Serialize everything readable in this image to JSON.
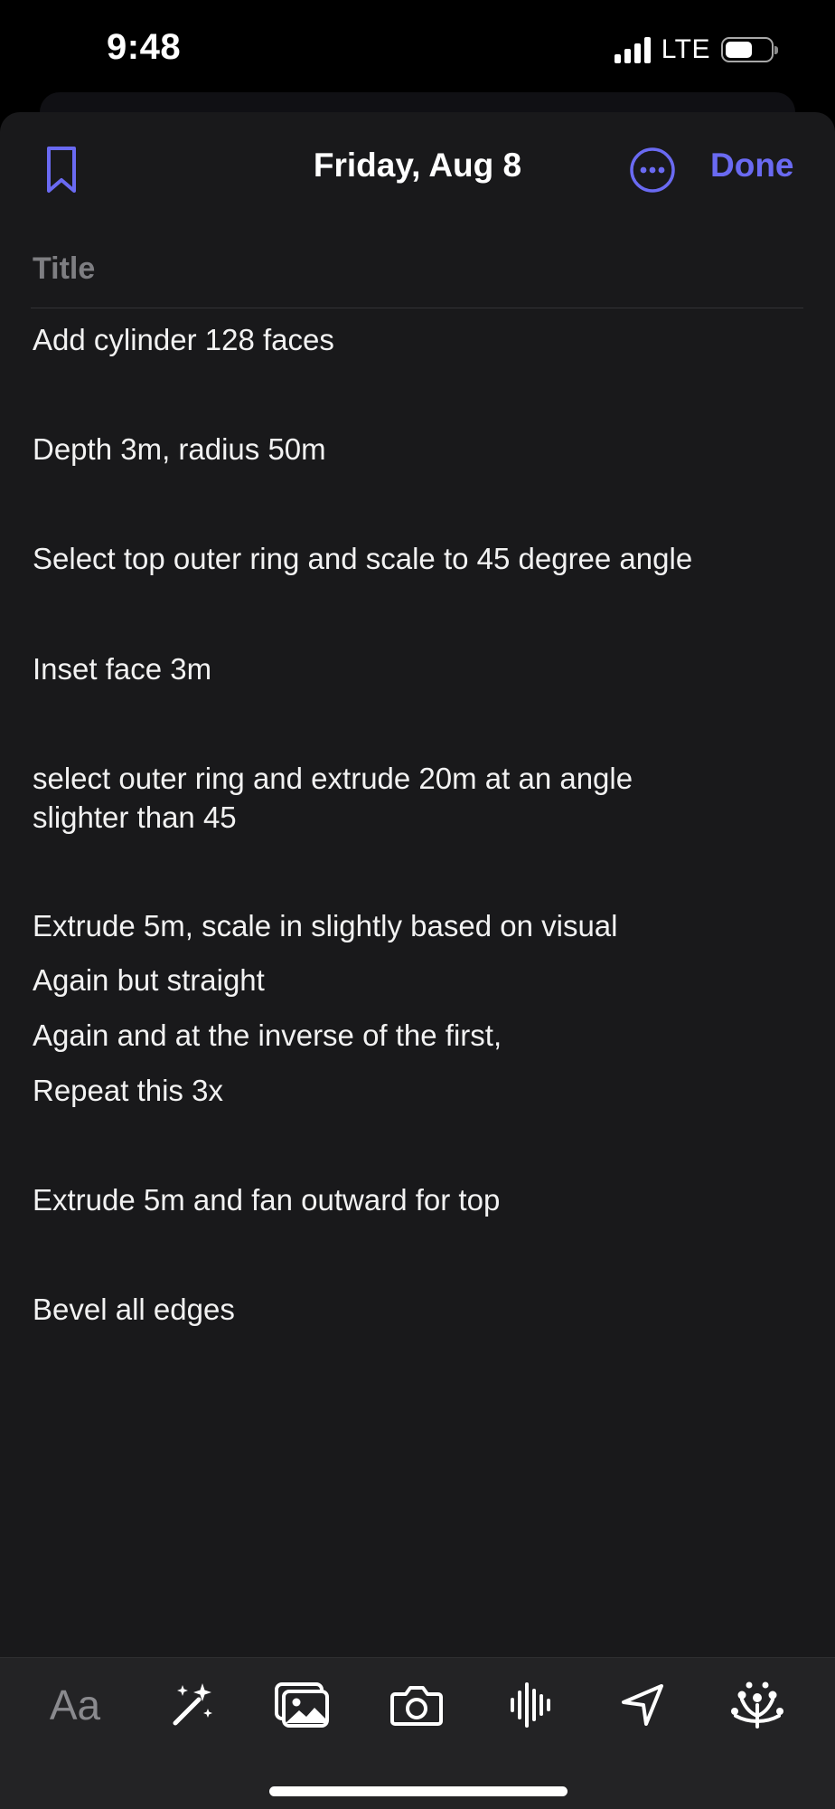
{
  "status_bar": {
    "time": "9:48",
    "network": "LTE",
    "battery_level": 0.6
  },
  "header": {
    "date_title": "Friday, Aug 8",
    "done_label": "Done",
    "accent_color": "#6a6af2",
    "bookmark_icon": "bookmark-icon",
    "more_icon": "ellipsis-circle-icon"
  },
  "note": {
    "title_placeholder": "Title",
    "lines": [
      "Add cylinder 128 faces",
      "Depth 3m, radius 50m",
      "Select top outer ring and scale to 45 degree angle",
      "Inset face 3m",
      "select outer ring and extrude 20m at an angle",
      "slighter than 45",
      "Extrude 5m, scale in slightly based on visual",
      "Again but straight",
      "Again and at the inverse of the first,",
      "Repeat this 3x",
      "Extrude 5m and fan outward for top",
      "Bevel all edges"
    ]
  },
  "toolbar": {
    "format_label": "Aa",
    "icons": [
      "text-format-icon",
      "magic-wand-icon",
      "photo-library-icon",
      "camera-icon",
      "audio-waveform-icon",
      "location-arrow-icon",
      "state-of-mind-icon"
    ]
  }
}
